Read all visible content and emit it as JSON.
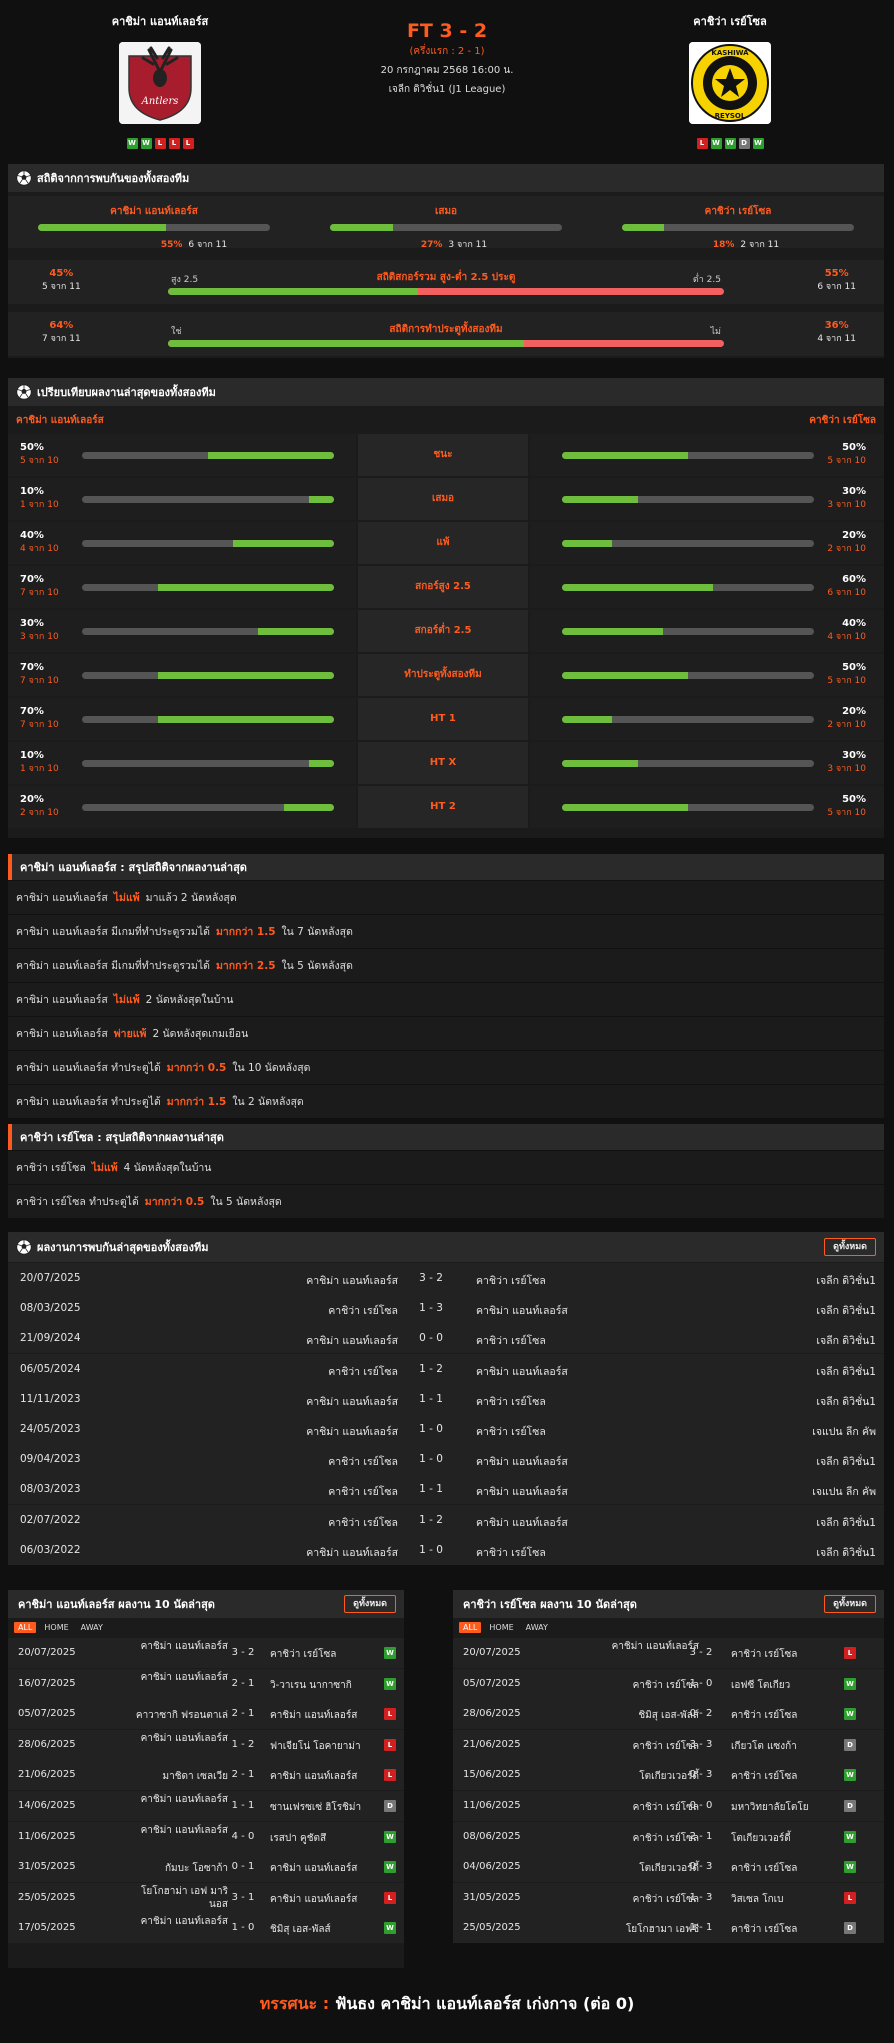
{
  "header": {
    "home_name": "คาชิม่า แอนท์เลอร์ส",
    "away_name": "คาชิว่า เรย์โซล",
    "score": "FT 3 - 2",
    "halftime": "(ครึ่งแรก : 2 - 1)",
    "datetime": "20 กรกฎาคม 2568 16:00 น.",
    "league": "เจลีก ดิวิชั่น1 (J1 League)",
    "home_logo_text": "Antlers",
    "away_logo_text_top": "KASHIWA",
    "away_logo_text_bottom": "REYSOL",
    "home_form": [
      "W",
      "W",
      "L",
      "L",
      "L"
    ],
    "away_form": [
      "L",
      "W",
      "W",
      "D",
      "W"
    ]
  },
  "h2h_stats": {
    "title": "สถิติจากการพบกันของทั้งสองทีม",
    "home": {
      "label": "คาชิม่า แอนท์เลอร์ส",
      "pct": "55%",
      "count": "6 จาก 11",
      "value": 55
    },
    "draw": {
      "label": "เสมอ",
      "pct": "27%",
      "count": "3 จาก 11",
      "value": 27
    },
    "away": {
      "label": "คาชิว่า เรย์โซล",
      "pct": "18%",
      "count": "2 จาก 11",
      "value": 18
    },
    "ou": {
      "title": "สถิติสกอร์รวม สูง-ต่ำ 2.5 ประตู",
      "left_label": "สูง 2.5",
      "right_label": "ต่ำ 2.5",
      "left_pct": "45%",
      "left_count": "5 จาก 11",
      "right_pct": "55%",
      "right_count": "6 จาก 11",
      "value": 45
    },
    "btts": {
      "title": "สถิติการทำประตูทั้งสองทีม",
      "left_label": "ใช่",
      "right_label": "ไม่",
      "left_pct": "64%",
      "left_count": "7 จาก 11",
      "right_pct": "36%",
      "right_count": "4 จาก 11",
      "value": 64
    }
  },
  "comparison": {
    "title": "เปรียบเทียบผลงานล่าสุดของทั้งสองทีม",
    "home_name": "คาชิม่า แอนท์เลอร์ส",
    "away_name": "คาชิว่า เรย์โซล",
    "rows": [
      {
        "label": "ชนะ",
        "hp": "50%",
        "hc": "5 จาก 10",
        "hv": 50,
        "ap": "50%",
        "ac": "5 จาก 10",
        "av": 50
      },
      {
        "label": "เสมอ",
        "hp": "10%",
        "hc": "1 จาก 10",
        "hv": 10,
        "ap": "30%",
        "ac": "3 จาก 10",
        "av": 30
      },
      {
        "label": "แพ้",
        "hp": "40%",
        "hc": "4 จาก 10",
        "hv": 40,
        "ap": "20%",
        "ac": "2 จาก 10",
        "av": 20
      },
      {
        "label": "สกอร์สูง 2.5",
        "hp": "70%",
        "hc": "7 จาก 10",
        "hv": 70,
        "ap": "60%",
        "ac": "6 จาก 10",
        "av": 60
      },
      {
        "label": "สกอร์ต่ำ 2.5",
        "hp": "30%",
        "hc": "3 จาก 10",
        "hv": 30,
        "ap": "40%",
        "ac": "4 จาก 10",
        "av": 40
      },
      {
        "label": "ทำประตูทั้งสองทีม",
        "hp": "70%",
        "hc": "7 จาก 10",
        "hv": 70,
        "ap": "50%",
        "ac": "5 จาก 10",
        "av": 50
      },
      {
        "label": "HT 1",
        "hp": "70%",
        "hc": "7 จาก 10",
        "hv": 70,
        "ap": "20%",
        "ac": "2 จาก 10",
        "av": 20
      },
      {
        "label": "HT X",
        "hp": "10%",
        "hc": "1 จาก 10",
        "hv": 10,
        "ap": "30%",
        "ac": "3 จาก 10",
        "av": 30
      },
      {
        "label": "HT 2",
        "hp": "20%",
        "hc": "2 จาก 10",
        "hv": 20,
        "ap": "50%",
        "ac": "5 จาก 10",
        "av": 50
      }
    ]
  },
  "home_summary": {
    "title": "คาชิม่า แอนท์เลอร์ส : สรุปสถิติจากผลงานล่าสุด",
    "rows": [
      {
        "pre": "คาชิม่า แอนท์เลอร์ส",
        "hl": "ไม่แพ้",
        "post": "มาแล้ว 2 นัดหลังสุด"
      },
      {
        "pre": "คาชิม่า แอนท์เลอร์ส มีเกมที่ทำประตูรวมได้",
        "hl": "มากกว่า 1.5",
        "post": "ใน 7 นัดหลังสุด"
      },
      {
        "pre": "คาชิม่า แอนท์เลอร์ส มีเกมที่ทำประตูรวมได้",
        "hl": "มากกว่า 2.5",
        "post": "ใน 5 นัดหลังสุด"
      },
      {
        "pre": "คาชิม่า แอนท์เลอร์ส",
        "hl": "ไม่แพ้",
        "post": "2 นัดหลังสุดในบ้าน"
      },
      {
        "pre": "คาชิม่า แอนท์เลอร์ส",
        "hl": "พ่ายแพ้",
        "post": "2 นัดหลังสุดเกมเยือน"
      },
      {
        "pre": "คาชิม่า แอนท์เลอร์ส ทำประตูได้",
        "hl": "มากกว่า 0.5",
        "post": "ใน 10 นัดหลังสุด"
      },
      {
        "pre": "คาชิม่า แอนท์เลอร์ส ทำประตูได้",
        "hl": "มากกว่า 1.5",
        "post": "ใน 2 นัดหลังสุด"
      }
    ]
  },
  "away_summary": {
    "title": "คาชิว่า เรย์โซล : สรุปสถิติจากผลงานล่าสุด",
    "rows": [
      {
        "pre": "คาชิว่า เรย์โซล",
        "hl": "ไม่แพ้",
        "post": "4 นัดหลังสุดในบ้าน"
      },
      {
        "pre": "คาชิว่า เรย์โซล ทำประตูได้",
        "hl": "มากกว่า 0.5",
        "post": "ใน 5 นัดหลังสุด"
      }
    ]
  },
  "h2h_list": {
    "title": "ผลงานการพบกันล่าสุดของทั้งสองทีม",
    "view_all": "ดูทั้งหมด",
    "rows": [
      {
        "date": "20/07/2025",
        "home": "คาชิม่า แอนท์เลอร์ส",
        "score": "3 - 2",
        "away": "คาชิว่า เรย์โซล",
        "league": "เจลีก ดิวิชั่น1"
      },
      {
        "date": "08/03/2025",
        "home": "คาชิว่า เรย์โซล",
        "score": "1 - 3",
        "away": "คาชิม่า แอนท์เลอร์ส",
        "league": "เจลีก ดิวิชั่น1"
      },
      {
        "date": "21/09/2024",
        "home": "คาชิม่า แอนท์เลอร์ส",
        "score": "0 - 0",
        "away": "คาชิว่า เรย์โซล",
        "league": "เจลีก ดิวิชั่น1"
      },
      {
        "date": "06/05/2024",
        "home": "คาชิว่า เรย์โซล",
        "score": "1 - 2",
        "away": "คาชิม่า แอนท์เลอร์ส",
        "league": "เจลีก ดิวิชั่น1"
      },
      {
        "date": "11/11/2023",
        "home": "คาชิม่า แอนท์เลอร์ส",
        "score": "1 - 1",
        "away": "คาชิว่า เรย์โซล",
        "league": "เจลีก ดิวิชั่น1"
      },
      {
        "date": "24/05/2023",
        "home": "คาชิม่า แอนท์เลอร์ส",
        "score": "1 - 0",
        "away": "คาชิว่า เรย์โซล",
        "league": "เจแปน ลีก คัพ"
      },
      {
        "date": "09/04/2023",
        "home": "คาชิว่า เรย์โซล",
        "score": "1 - 0",
        "away": "คาชิม่า แอนท์เลอร์ส",
        "league": "เจลีก ดิวิชั่น1"
      },
      {
        "date": "08/03/2023",
        "home": "คาชิว่า เรย์โซล",
        "score": "1 - 1",
        "away": "คาชิม่า แอนท์เลอร์ส",
        "league": "เจแปน ลีก คัพ"
      },
      {
        "date": "02/07/2022",
        "home": "คาชิว่า เรย์โซล",
        "score": "1 - 2",
        "away": "คาชิม่า แอนท์เลอร์ส",
        "league": "เจลีก ดิวิชั่น1"
      },
      {
        "date": "06/03/2022",
        "home": "คาชิม่า แอนท์เลอร์ส",
        "score": "1 - 0",
        "away": "คาชิว่า เรย์โซล",
        "league": "เจลีก ดิวิชั่น1"
      }
    ]
  },
  "home_last10": {
    "title": "คาชิม่า แอนท์เลอร์ส ผลงาน 10 นัดล่าสุด",
    "view_all": "ดูทั้งหมด",
    "tabs": [
      "ALL",
      "HOME",
      "AWAY"
    ],
    "rows": [
      {
        "date": "20/07/2025",
        "home": "คาชิม่า แอนท์เลอร์ส",
        "score": "3 - 2",
        "away": "คาชิว่า เรย์โซล",
        "res": "W"
      },
      {
        "date": "16/07/2025",
        "home": "คาชิม่า แอนท์เลอร์ส",
        "score": "2 - 1",
        "away": "วิ-วาเรน นากาซากิ",
        "res": "W"
      },
      {
        "date": "05/07/2025",
        "home": "คาวาซากิ ฟรอนตาเล่",
        "score": "2 - 1",
        "away": "คาชิม่า แอนท์เลอร์ส",
        "res": "L"
      },
      {
        "date": "28/06/2025",
        "home": "คาชิม่า แอนท์เลอร์ส",
        "score": "1 - 2",
        "away": "ฟาเจียโน่ โอคายาม่า",
        "res": "L"
      },
      {
        "date": "21/06/2025",
        "home": "มาชิดา เซลเวีย",
        "score": "2 - 1",
        "away": "คาชิม่า แอนท์เลอร์ส",
        "res": "L"
      },
      {
        "date": "14/06/2025",
        "home": "คาชิม่า แอนท์เลอร์ส",
        "score": "1 - 1",
        "away": "ซานเฟรซเซ่ ฮิโรชิม่า",
        "res": "D"
      },
      {
        "date": "11/06/2025",
        "home": "คาชิม่า แอนท์เลอร์ส",
        "score": "4 - 0",
        "away": "เรสปา คูชัตสึ",
        "res": "W"
      },
      {
        "date": "31/05/2025",
        "home": "กัมบะ โอซาก้า",
        "score": "0 - 1",
        "away": "คาชิม่า แอนท์เลอร์ส",
        "res": "W"
      },
      {
        "date": "25/05/2025",
        "home": "โยโกฮาม่า เอฟ มารินอส",
        "score": "3 - 1",
        "away": "คาชิม่า แอนท์เลอร์ส",
        "res": "L"
      },
      {
        "date": "17/05/2025",
        "home": "คาชิม่า แอนท์เลอร์ส",
        "score": "1 - 0",
        "away": "ชิมิสุ เอส-พัลส์",
        "res": "W"
      }
    ]
  },
  "away_last10": {
    "title": "คาชิว่า เรย์โซล ผลงาน 10 นัดล่าสุด",
    "view_all": "ดูทั้งหมด",
    "tabs": [
      "ALL",
      "HOME",
      "AWAY"
    ],
    "rows": [
      {
        "date": "20/07/2025",
        "home": "คาชิม่า แอนท์เลอร์ส",
        "score": "3 - 2",
        "away": "คาชิว่า เรย์โซล",
        "res": "L"
      },
      {
        "date": "05/07/2025",
        "home": "คาชิว่า เรย์โซล",
        "score": "1 - 0",
        "away": "เอฟซี โตเกียว",
        "res": "W"
      },
      {
        "date": "28/06/2025",
        "home": "ชิมิสุ เอส-พัลส์",
        "score": "0 - 2",
        "away": "คาชิว่า เรย์โซล",
        "res": "W"
      },
      {
        "date": "21/06/2025",
        "home": "คาชิว่า เรย์โซล",
        "score": "3 - 3",
        "away": "เกียวโต แซงก้า",
        "res": "D"
      },
      {
        "date": "15/06/2025",
        "home": "โตเกียวเวอร์ดี้",
        "score": "0 - 3",
        "away": "คาชิว่า เรย์โซล",
        "res": "W"
      },
      {
        "date": "11/06/2025",
        "home": "คาชิว่า เรย์โซล",
        "score": "0 - 0",
        "away": "มหาวิทยาลัยโตโย",
        "res": "D"
      },
      {
        "date": "08/06/2025",
        "home": "คาชิว่า เรย์โซล",
        "score": "2 - 1",
        "away": "โตเกียวเวอร์ดี้",
        "res": "W"
      },
      {
        "date": "04/06/2025",
        "home": "โตเกียวเวอร์ดี้",
        "score": "0 - 3",
        "away": "คาชิว่า เรย์โซล",
        "res": "W"
      },
      {
        "date": "31/05/2025",
        "home": "คาชิว่า เรย์โซล",
        "score": "1 - 3",
        "away": "วิสเซล โกเบ",
        "res": "L"
      },
      {
        "date": "25/05/2025",
        "home": "โยโกฮามา เอฟซี",
        "score": "1 - 1",
        "away": "คาชิว่า เรย์โซล",
        "res": "D"
      }
    ]
  },
  "verdict": {
    "label": "ทรรศนะ :",
    "text": "ฟันธง คาชิม่า แอนท์เลอร์ส เก่งกาจ (ต่อ 0)"
  },
  "colors": {
    "accent": "#ff5b1f",
    "bar_green": "#6fbd3c",
    "bar_red": "#f26060",
    "win": "#2e9e2e",
    "loss": "#d22020",
    "draw": "#777777"
  }
}
